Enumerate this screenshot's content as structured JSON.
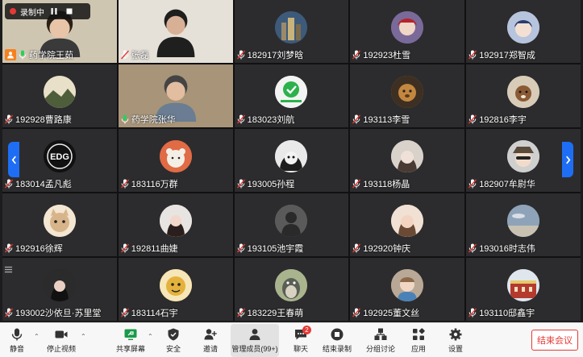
{
  "recording": {
    "label": "录制中"
  },
  "participants": [
    {
      "name": "药学院王茹",
      "kind": "video",
      "host": true,
      "mic": "on",
      "avatar": "person-glasses",
      "bg": "#cfc6b2"
    },
    {
      "name": "张磊",
      "kind": "video",
      "mic": "muted",
      "avatar": "person-dark",
      "bg": "#e6e1d8"
    },
    {
      "name": "182917刘梦晗",
      "kind": "avatar",
      "mic": "muted",
      "avatar": "art-city",
      "bg": "#3d5a7a"
    },
    {
      "name": "192923杜雪",
      "kind": "avatar",
      "mic": "muted",
      "avatar": "anime-red",
      "bg": "#7a6a9a"
    },
    {
      "name": "192917郑智成",
      "kind": "avatar",
      "mic": "muted",
      "avatar": "anime-blue",
      "bg": "#b6c4dd"
    },
    {
      "name": "192928曹路康",
      "kind": "avatar",
      "mic": "muted",
      "avatar": "landscape",
      "bg": "#6c7b5a"
    },
    {
      "name": "药学院张华",
      "kind": "video",
      "mic": "on",
      "avatar": "person-shelf",
      "bg": "#a89478"
    },
    {
      "name": "183023刘航",
      "kind": "avatar",
      "mic": "muted",
      "avatar": "green-check",
      "bg": "#f3f3f3"
    },
    {
      "name": "193113李雪",
      "kind": "avatar",
      "mic": "muted",
      "avatar": "dog-brown",
      "bg": "#c4873f"
    },
    {
      "name": "192816李宇",
      "kind": "avatar",
      "mic": "muted",
      "avatar": "dog-small",
      "bg": "#d8cbb8"
    },
    {
      "name": "183014孟凡彪",
      "kind": "avatar",
      "mic": "muted",
      "avatar": "edg-logo",
      "bg": "#111111"
    },
    {
      "name": "183116万群",
      "kind": "avatar",
      "mic": "muted",
      "avatar": "bear-white",
      "bg": "#e06b45"
    },
    {
      "name": "193005孙程",
      "kind": "avatar",
      "mic": "muted",
      "avatar": "sketch-girl",
      "bg": "#e9e9e9"
    },
    {
      "name": "193118杨晶",
      "kind": "avatar",
      "mic": "muted",
      "avatar": "sketch-lady",
      "bg": "#d9d2cb"
    },
    {
      "name": "182907牟尉华",
      "kind": "avatar",
      "mic": "muted",
      "avatar": "cartoon-hat",
      "bg": "#cfcfcf"
    },
    {
      "name": "192916徐辉",
      "kind": "avatar",
      "mic": "muted",
      "avatar": "cat-face",
      "bg": "#d8b48a"
    },
    {
      "name": "192811曲婕",
      "kind": "avatar",
      "mic": "muted",
      "avatar": "girl-photo",
      "bg": "#e8e4e2"
    },
    {
      "name": "193105池宇霞",
      "kind": "avatar",
      "mic": "muted",
      "avatar": "silhouette",
      "bg": "#5a5a5a"
    },
    {
      "name": "192920钟庆",
      "kind": "avatar",
      "mic": "muted",
      "avatar": "girl-smile",
      "bg": "#e7c9b7"
    },
    {
      "name": "193016时志伟",
      "kind": "avatar",
      "mic": "muted",
      "avatar": "sky",
      "bg": "#8fa3b8"
    },
    {
      "name": "193002沙依旦·苏里堂",
      "kind": "avatar",
      "mic": "muted",
      "avatar": "girl-dark",
      "bg": "#2b2b2b"
    },
    {
      "name": "183114石宇",
      "kind": "avatar",
      "mic": "muted",
      "avatar": "cartoon-yellow",
      "bg": "#e4b23c"
    },
    {
      "name": "183229王春萌",
      "kind": "avatar",
      "mic": "muted",
      "avatar": "totoro",
      "bg": "#7f8a6e"
    },
    {
      "name": "192925董文丝",
      "kind": "avatar",
      "mic": "muted",
      "avatar": "kid-photo",
      "bg": "#b9a896"
    },
    {
      "name": "193110邸鑫宇",
      "kind": "avatar",
      "mic": "muted",
      "avatar": "building",
      "bg": "#c7c0b2"
    }
  ],
  "toolbar": {
    "mute": "静音",
    "stop_video": "停止视频",
    "share_screen": "共享屏幕",
    "security": "安全",
    "invite": "邀请",
    "manage_members": "管理成员(99+)",
    "chat": "聊天",
    "chat_badge": "2",
    "end_recording": "结束录制",
    "breakout": "分组讨论",
    "apps": "应用",
    "settings": "设置",
    "end_meeting": "结束会议"
  },
  "colors": {
    "accent": "#1e6ef5",
    "danger": "#e53935",
    "host": "#f5821f"
  }
}
